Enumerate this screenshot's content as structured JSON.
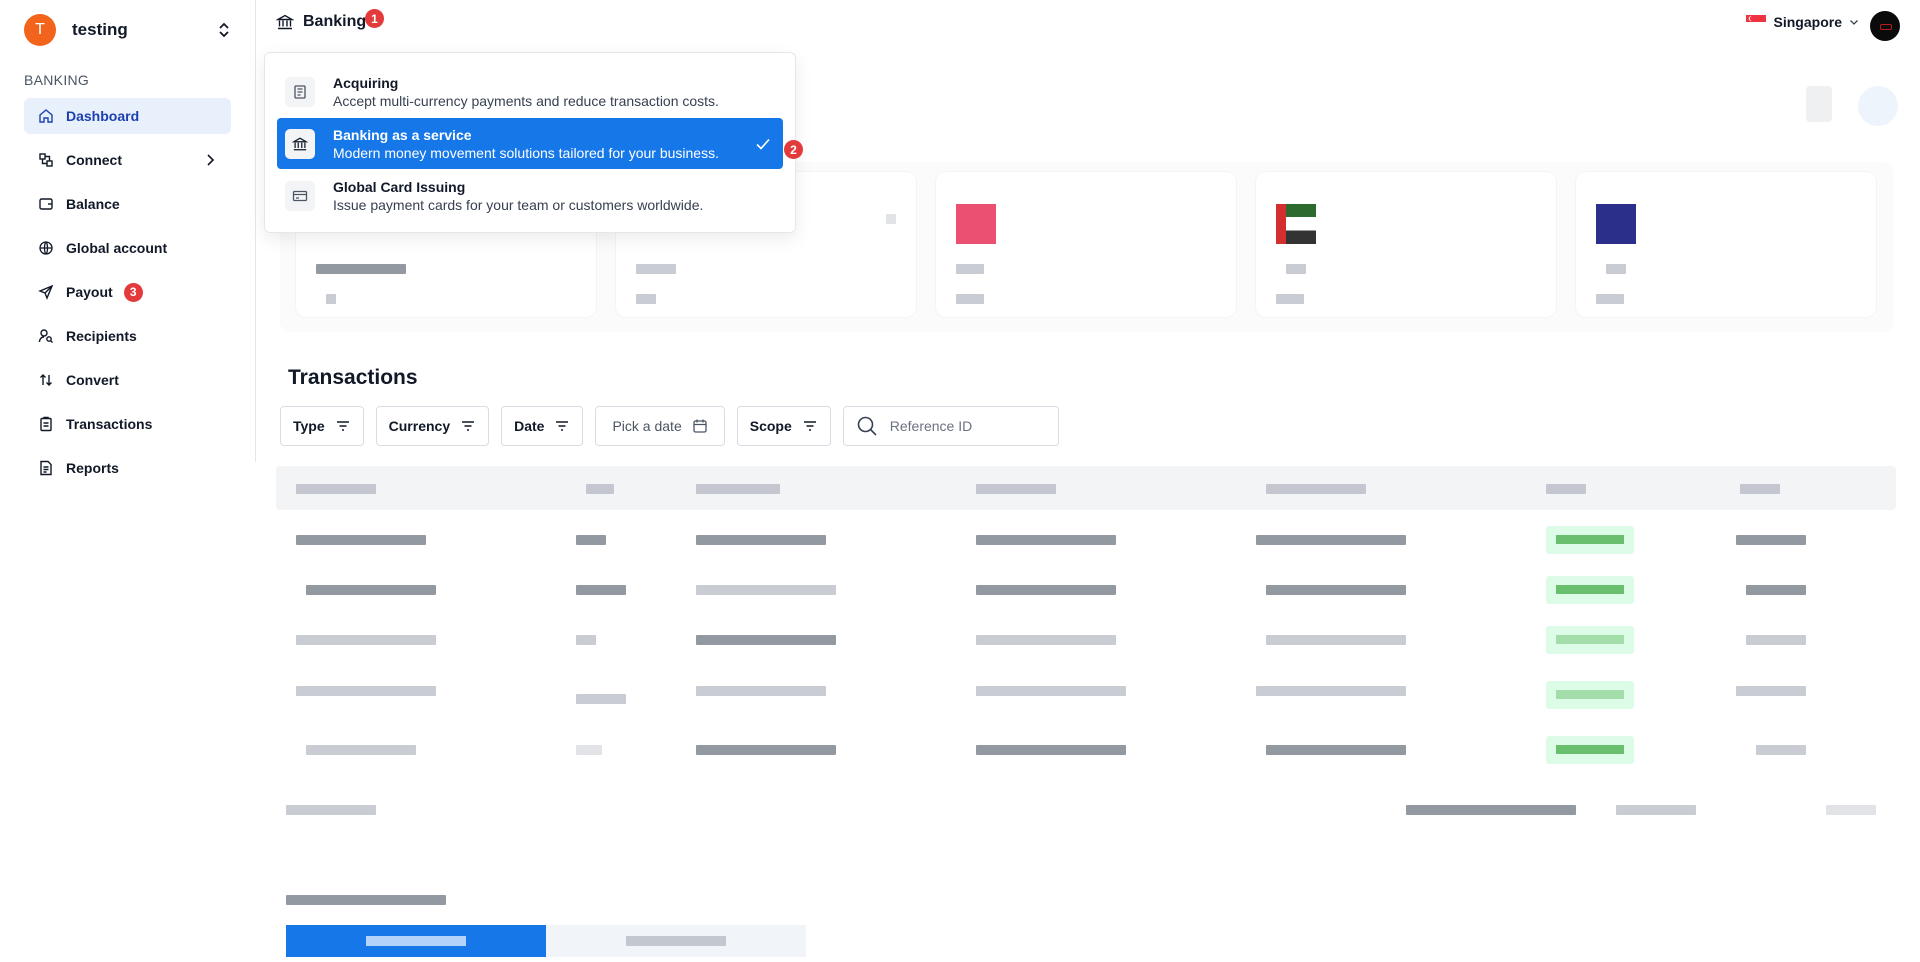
{
  "sidebar": {
    "org_initial": "T",
    "org_name": "testing",
    "section_label": "BANKING",
    "items": [
      {
        "label": "Dashboard"
      },
      {
        "label": "Connect"
      },
      {
        "label": "Balance"
      },
      {
        "label": "Global account"
      },
      {
        "label": "Payout",
        "badge": "3"
      },
      {
        "label": "Recipients"
      },
      {
        "label": "Convert"
      },
      {
        "label": "Transactions"
      },
      {
        "label": "Reports"
      }
    ],
    "active_color": "#1e40af"
  },
  "header": {
    "product": "Banking",
    "product_badge": "1",
    "region": "Singapore"
  },
  "dropdown": {
    "items": [
      {
        "title": "Acquiring",
        "desc": "Accept multi-currency payments and reduce transaction costs."
      },
      {
        "title": "Banking as a service",
        "desc": "Modern money movement solutions tailored for your business."
      },
      {
        "title": "Global Card Issuing",
        "desc": "Issue payment cards for your team or customers worldwide."
      }
    ],
    "selected_badge": "2",
    "selected_color": "#1677e8"
  },
  "transactions": {
    "title": "Transactions",
    "filters": {
      "type": "Type",
      "currency": "Currency",
      "date": "Date",
      "pick_date": "Pick a date",
      "scope": "Scope",
      "search_placeholder": "Reference ID"
    }
  },
  "colors": {
    "badge": "#e33b3b",
    "org_avatar": "#f2631c"
  }
}
